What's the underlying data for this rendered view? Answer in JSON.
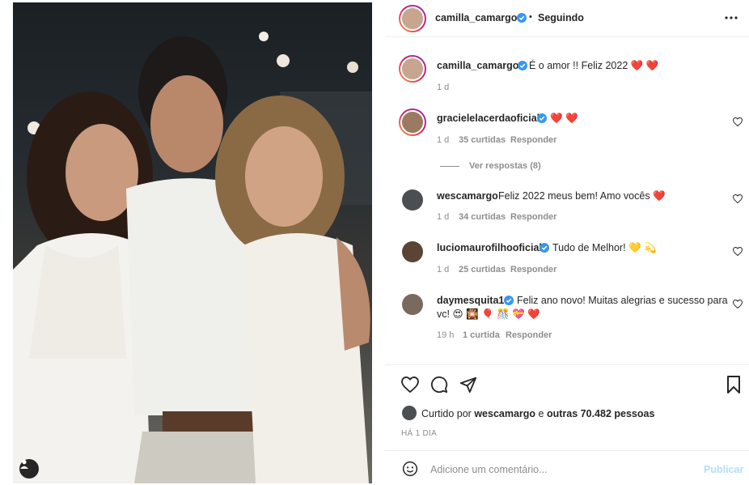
{
  "post": {
    "author": "camilla_camargo",
    "follow_separator": "•",
    "follow_label": "Seguindo",
    "caption": "É o amor !! Feliz 2022 ❤️ ❤️",
    "caption_time": "1 d"
  },
  "comments": [
    {
      "user": "gracielelacerdaoficial",
      "verified": true,
      "text": "❤️ ❤️",
      "time": "1 d",
      "likes": "35 curtidas",
      "reply": "Responder",
      "view_replies": "Ver respostas (8)"
    },
    {
      "user": "wescamargo",
      "verified": false,
      "text": "Feliz 2022 meus bem! Amo vocês ❤️",
      "time": "1 d",
      "likes": "34 curtidas",
      "reply": "Responder"
    },
    {
      "user": "luciomaurofilhooficial",
      "verified": true,
      "text": "Tudo de Melhor! 💛 💫",
      "time": "1 d",
      "likes": "25 curtidas",
      "reply": "Responder"
    },
    {
      "user": "daymesquita1",
      "verified": true,
      "text_line1": "Feliz ano novo! Muitas alegrias e sucesso para",
      "text_line2": "vc! 😍 🎇 🎈 🎊 💝 ❤️",
      "time": "19 h",
      "likes": "1 curtida",
      "reply": "Responder"
    }
  ],
  "likes_summary": {
    "prefix": "Curtido por",
    "user": "wescamargo",
    "middle": "e",
    "others": "outras 70.482 pessoas"
  },
  "post_age": "HÁ 1 DIA",
  "comment_input": {
    "placeholder": "Adicione um comentário...",
    "publish_label": "Publicar"
  },
  "colors": {
    "verified_blue": "#3897f0",
    "heart_red": "#ed4956",
    "publish_disabled": "#b2dffc",
    "secondary_text": "#8e8e8e"
  },
  "icons": [
    "more-options-icon",
    "heart-icon",
    "comment-icon",
    "share-icon",
    "bookmark-icon",
    "emoji-icon",
    "user-tag-icon",
    "verified-badge-icon"
  ]
}
